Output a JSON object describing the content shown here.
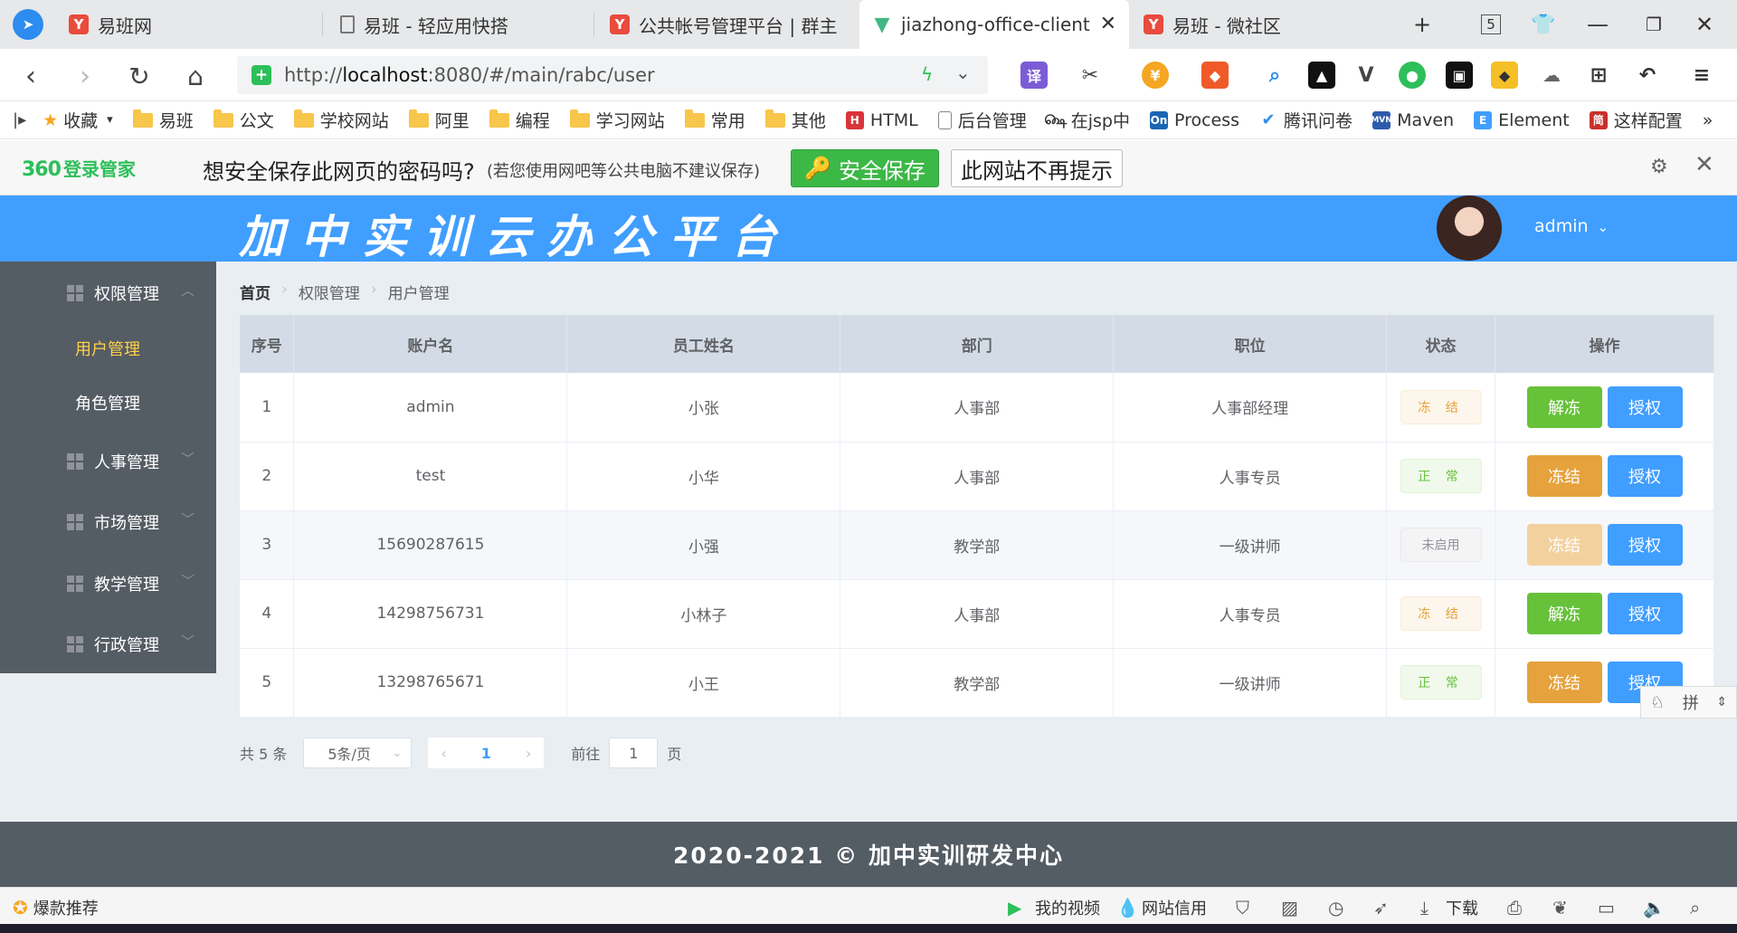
{
  "browser": {
    "tabs": [
      {
        "title": "易班网",
        "active": false
      },
      {
        "title": "易班 - 轻应用快搭",
        "active": false
      },
      {
        "title": "公共帐号管理平台 | 群主",
        "active": false
      },
      {
        "title": "jiazhong-office-client",
        "active": true
      },
      {
        "title": "易班 - 微社区",
        "active": false
      }
    ],
    "tab_count": "5",
    "url_prefix": "http://",
    "url_host": "localhost",
    "url_rest": ":8080/#/main/rabc/user",
    "extension_badge": "译",
    "bookmarks": [
      "收藏",
      "易班",
      "公文",
      "学校网站",
      "阿里",
      "编程",
      "学习网站",
      "常用",
      "其他",
      "HTML",
      "后台管理",
      "在jsp中",
      "Process",
      "腾讯问卷",
      "Maven",
      "Element",
      "这样配置"
    ],
    "more": "»"
  },
  "password_bar": {
    "brand": "360",
    "brand_suffix": "登录管家",
    "question": "想安全保存此网页的密码吗?",
    "note": "(若您使用网吧等公共电脑不建议保存)",
    "save_label": "安全保存",
    "never_label": "此网站不再提示"
  },
  "app": {
    "title": "加中实训云办公平台",
    "user": "admin",
    "colors": {
      "header": "#409eff",
      "sidebar": "#545c64",
      "active_menu": "#ffd04b"
    }
  },
  "sidebar": {
    "groups": [
      {
        "label": "权限管理",
        "expanded": true,
        "children": [
          {
            "label": "用户管理",
            "active": true
          },
          {
            "label": "角色管理",
            "active": false
          }
        ]
      },
      {
        "label": "人事管理",
        "expanded": false
      },
      {
        "label": "市场管理",
        "expanded": false
      },
      {
        "label": "教学管理",
        "expanded": false
      },
      {
        "label": "行政管理",
        "expanded": false
      }
    ]
  },
  "breadcrumb": [
    "首页",
    "权限管理",
    "用户管理"
  ],
  "table": {
    "headers": [
      "序号",
      "账户名",
      "员工姓名",
      "部门",
      "职位",
      "状态",
      "操作"
    ],
    "rows": [
      {
        "no": "1",
        "account": "admin",
        "name": "小张",
        "dept": "人事部",
        "position": "人事部经理",
        "status": "冻 结",
        "status_type": "frozen",
        "action": "解冻",
        "grant": "授权"
      },
      {
        "no": "2",
        "account": "test",
        "name": "小华",
        "dept": "人事部",
        "position": "人事专员",
        "status": "正 常",
        "status_type": "normal",
        "action": "冻结",
        "grant": "授权"
      },
      {
        "no": "3",
        "account": "15690287615",
        "name": "小强",
        "dept": "教学部",
        "position": "一级讲师",
        "status": "未启用",
        "status_type": "idle",
        "action": "冻结",
        "grant": "授权"
      },
      {
        "no": "4",
        "account": "14298756731",
        "name": "小林子",
        "dept": "人事部",
        "position": "人事专员",
        "status": "冻 结",
        "status_type": "frozen",
        "action": "解冻",
        "grant": "授权"
      },
      {
        "no": "5",
        "account": "13298765671",
        "name": "小王",
        "dept": "教学部",
        "position": "一级讲师",
        "status": "正 常",
        "status_type": "normal",
        "action": "冻结",
        "grant": "授权"
      }
    ]
  },
  "pager": {
    "total": "共 5 条",
    "page_size": "5条/页",
    "current": "1",
    "goto_label": "前往",
    "goto_value": "1",
    "page_unit": "页"
  },
  "footer": "2020-2021 © 加中实训研发中心",
  "statusbar": {
    "left": "爆款推荐",
    "video": "我的视频",
    "credit": "网站信用",
    "download": "下载"
  },
  "ime": "拼"
}
